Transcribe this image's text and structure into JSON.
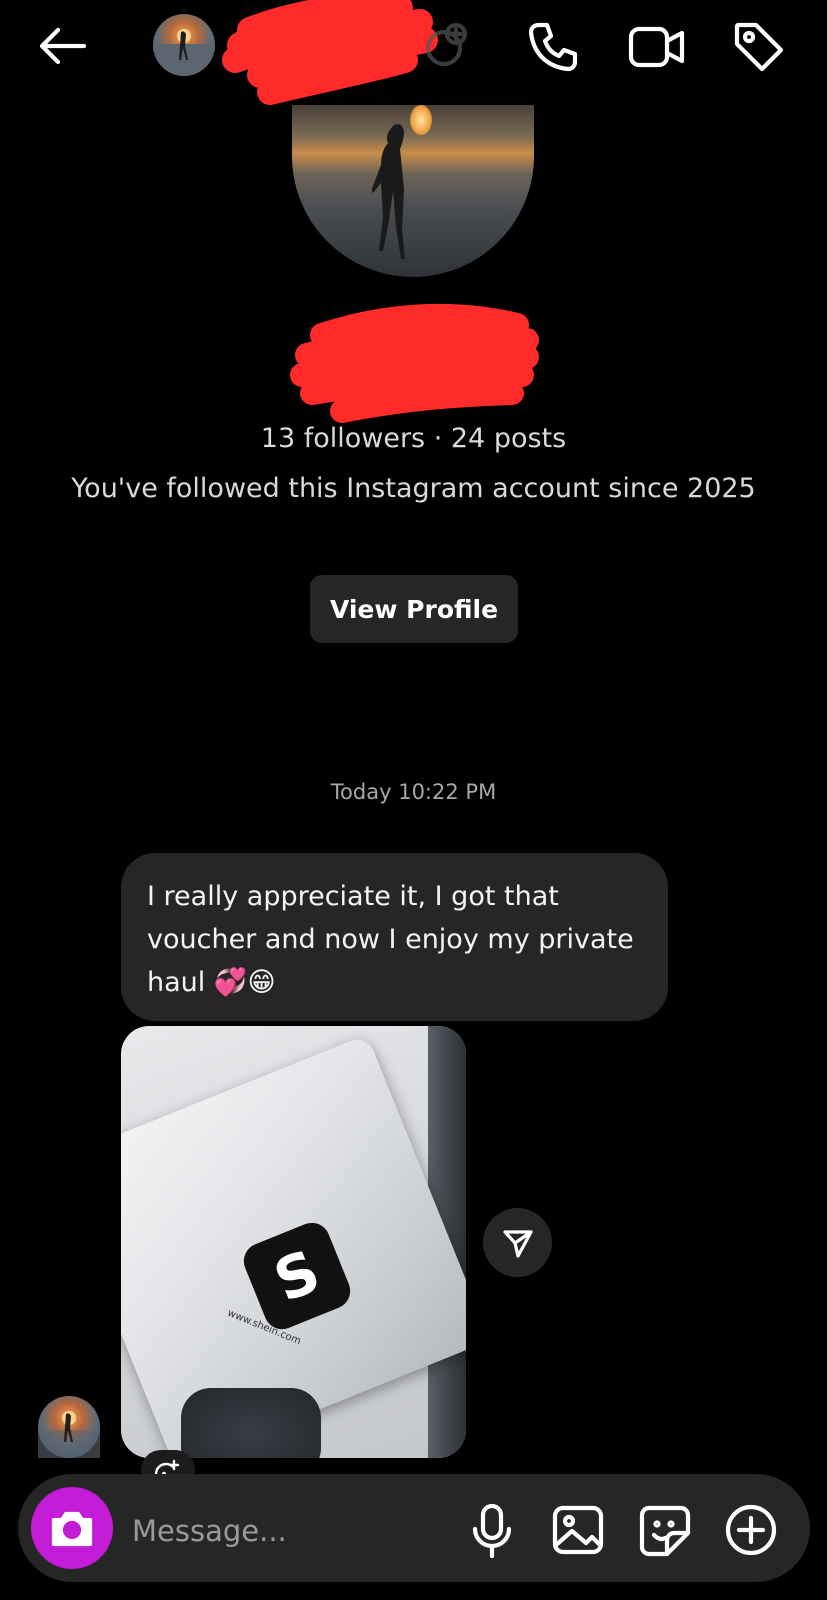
{
  "profile": {
    "followers_line": "13 followers · 24 posts",
    "follow_since": "You've followed this Instagram account since 2025",
    "view_profile_label": "View Profile"
  },
  "chat": {
    "timestamp": "Today 10:22 PM",
    "message_text": "I really appreciate it, I got that voucher and now I enjoy my private haul 💞😁",
    "image_brand_letter": "S",
    "image_brand_url": "www.shein.com"
  },
  "composer": {
    "placeholder": "Message..."
  },
  "icons": {
    "header": [
      "back-arrow-icon",
      "add-people-icon",
      "phone-icon",
      "video-camera-icon",
      "tag-icon"
    ],
    "composer": [
      "camera-icon",
      "microphone-icon",
      "gallery-icon",
      "sticker-icon",
      "plus-icon"
    ],
    "share": "send-icon",
    "react": "add-reaction-icon"
  },
  "colors": {
    "background": "#000000",
    "bubble": "#262626",
    "camera_button": "#c41bd6",
    "redaction": "#ff2b2b"
  }
}
